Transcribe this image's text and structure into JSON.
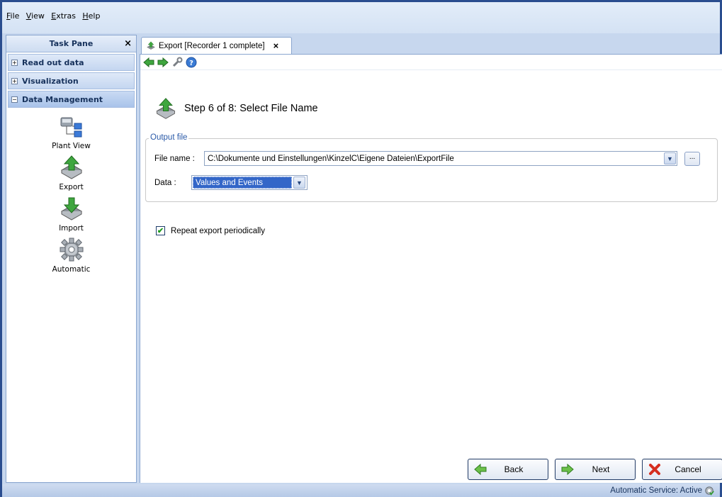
{
  "menu": {
    "items": [
      {
        "accel": "F",
        "rest": "ile"
      },
      {
        "accel": "V",
        "rest": "iew"
      },
      {
        "accel": "E",
        "rest": "xtras"
      },
      {
        "accel": "H",
        "rest": "elp"
      }
    ]
  },
  "taskpane": {
    "title": "Task Pane",
    "close": "×",
    "sections": [
      {
        "label": "Read out data",
        "state": "+"
      },
      {
        "label": "Visualization",
        "state": "+"
      },
      {
        "label": "Data Management",
        "state": "−"
      }
    ],
    "tools": [
      {
        "label": "Plant View",
        "icon": "plant-view-icon"
      },
      {
        "label": "Export",
        "icon": "export-icon"
      },
      {
        "label": "Import",
        "icon": "import-icon"
      },
      {
        "label": "Automatic",
        "icon": "gear-icon"
      }
    ]
  },
  "tab": {
    "label": "Export [Recorder 1 complete]",
    "close": "×"
  },
  "wizard": {
    "step_title": "Step 6 of 8: Select File Name"
  },
  "output": {
    "legend": "Output file",
    "file_label": "File name :",
    "file_value": "C:\\Dokumente und Einstellungen\\KinzelC\\Eigene Dateien\\ExportFile",
    "browse": "...",
    "data_label": "Data :",
    "data_value": "Values and Events"
  },
  "repeat": {
    "label": "Repeat export periodically",
    "checked": true
  },
  "buttons": {
    "back": "Back",
    "next": "Next",
    "cancel": "Cancel"
  },
  "status": {
    "text": "Automatic Service: Active"
  },
  "colors": {
    "accent": "#3366c8",
    "frame": "#2a4d8f",
    "arrow_green": "#3fa63f",
    "cancel_red": "#d62e1f"
  }
}
